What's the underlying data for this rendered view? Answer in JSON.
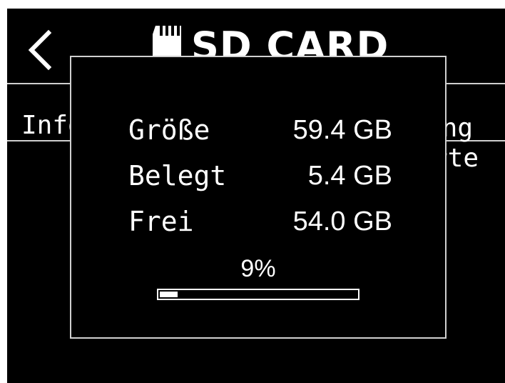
{
  "header": {
    "title": "SD CARD",
    "back_icon": "chevron-left-icon",
    "title_icon": "sd-card-icon"
  },
  "background": {
    "left_label": "Info",
    "right_label_1": "ung",
    "right_label_2": "rte"
  },
  "popup": {
    "rows": [
      {
        "label": "Größe",
        "value": "59.4 GB"
      },
      {
        "label": "Belegt",
        "value": "5.4 GB"
      },
      {
        "label": "Frei",
        "value": "54.0 GB"
      }
    ],
    "usage_percent_label": "9%",
    "usage_fraction": 0.09
  },
  "colors": {
    "screen_background": "#000000",
    "text": "#ffffff",
    "border": "#d0d0d0"
  }
}
